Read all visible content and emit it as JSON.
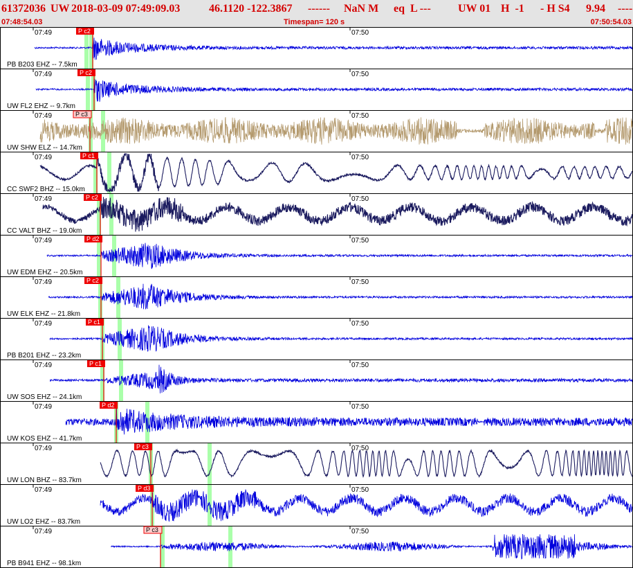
{
  "header": {
    "event_id": "61372036",
    "network": "UW",
    "datetime": "2018-03-09 07:49:09.03",
    "coords": "46.1120 -122.3867",
    "dash1": "------",
    "magnitude": "NaN M",
    "etype": "eq  L ---",
    "source": "UW 01",
    "h_code": "H  -1",
    "h_sub": "- H S4",
    "depth": "9.94",
    "dash2": "-----"
  },
  "subheader": {
    "start_time": "07:48:54.03",
    "timespan": "Timespan= 120 s",
    "end_time": "07:50:54.03"
  },
  "colors": {
    "header_bg": "#e4e4e4",
    "header_text": "#d40000",
    "trace_blue": "#0000dd",
    "trace_navy": "#1a1a5e",
    "trace_tan": "#b49a6e",
    "pick_red": "#ee0000",
    "pick_pink": "#ffcccc",
    "window_green": "#aaffaa"
  },
  "time_ticks": [
    "07:49",
    "07:50"
  ],
  "traces": [
    {
      "station": "PB B203 EHZ -- 7.5km",
      "pick": "P c2",
      "color": "blue",
      "pick_style": "solid"
    },
    {
      "station": "UW FL2 EHZ -- 9.7km",
      "pick": "P c2",
      "color": "blue",
      "pick_style": "solid"
    },
    {
      "station": "UW SHW ELZ -- 14.7km",
      "pick": "P c3",
      "color": "tan",
      "pick_style": "outline"
    },
    {
      "station": "CC SWF2 BHZ -- 15.0km",
      "pick": "P c1",
      "color": "navy",
      "pick_style": "solid"
    },
    {
      "station": "CC VALT BHZ -- 19.0km",
      "pick": "P c2",
      "color": "navy",
      "pick_style": "solid"
    },
    {
      "station": "UW EDM EHZ -- 20.5km",
      "pick": "P d2",
      "color": "blue",
      "pick_style": "solid"
    },
    {
      "station": "UW ELK EHZ -- 21.8km",
      "pick": "P c2",
      "color": "blue",
      "pick_style": "solid"
    },
    {
      "station": "PB B201 EHZ -- 23.2km",
      "pick": "P c1",
      "color": "blue",
      "pick_style": "solid"
    },
    {
      "station": "UW SOS EHZ -- 24.1km",
      "pick": "P c1",
      "color": "blue",
      "pick_style": "solid"
    },
    {
      "station": "UW KOS EHZ -- 41.7km",
      "pick": "P d2",
      "color": "blue",
      "pick_style": "solid"
    },
    {
      "station": "UW LON BHZ -- 83.7km",
      "pick": "P c3",
      "color": "navy",
      "pick_style": "solid"
    },
    {
      "station": "UW LO2 EHZ -- 83.7km",
      "pick": "P d3",
      "color": "blue",
      "pick_style": "solid"
    },
    {
      "station": "PB B941 EHZ -- 98.1km",
      "pick": "P c3",
      "color": "blue",
      "pick_style": "outline"
    }
  ]
}
